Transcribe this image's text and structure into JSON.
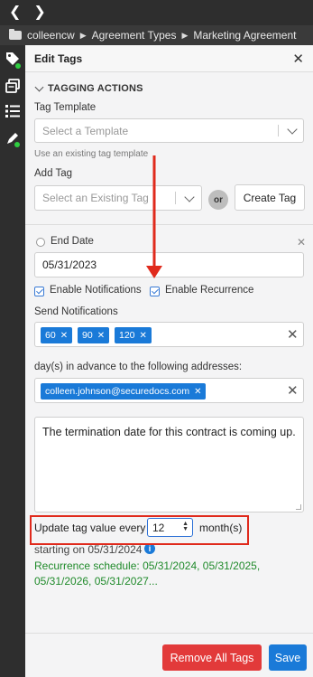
{
  "topbar": {
    "back_icon": "chevron-left-icon",
    "forward_icon": "chevron-right-icon"
  },
  "breadcrumb": {
    "items": [
      "colleencw",
      "Agreement Types",
      "Marketing Agreement"
    ]
  },
  "rail": {
    "icons": [
      "tag-icon",
      "copy-icon",
      "list-icon",
      "pen-icon"
    ]
  },
  "panel": {
    "title": "Edit Tags",
    "section": "TAGGING ACTIONS",
    "tag_template": {
      "label": "Tag Template",
      "placeholder": "Select a Template",
      "hint": "Use an existing tag template"
    },
    "add_tag": {
      "label": "Add Tag",
      "placeholder": "Select an Existing Tag",
      "or": "or",
      "create_button": "Create Tag"
    },
    "end_date": {
      "label": "End Date",
      "value": "05/31/2023",
      "enable_notifications": "Enable Notifications",
      "enable_recurrence": "Enable Recurrence",
      "send_notifications_label": "Send Notifications",
      "notification_days": [
        "60",
        "90",
        "120"
      ],
      "addresses_label": "day(s) in advance to the following addresses:",
      "addresses": [
        "colleen.johnson@securedocs.com"
      ],
      "message": "The termination date for this contract is coming up.",
      "update_prefix": "Update tag value every",
      "update_value": "12",
      "update_suffix": "month(s)",
      "starting": "starting on 05/31/2024",
      "schedule": "Recurrence schedule: 05/31/2024, 05/31/2025, 05/31/2026, 05/31/2027..."
    },
    "footer": {
      "remove_all": "Remove All Tags",
      "save": "Save"
    }
  },
  "colors": {
    "accent": "#1a7ad8",
    "danger": "#e23a3a",
    "annotation": "#e02a1c",
    "schedule_green": "#1f8a2a"
  }
}
